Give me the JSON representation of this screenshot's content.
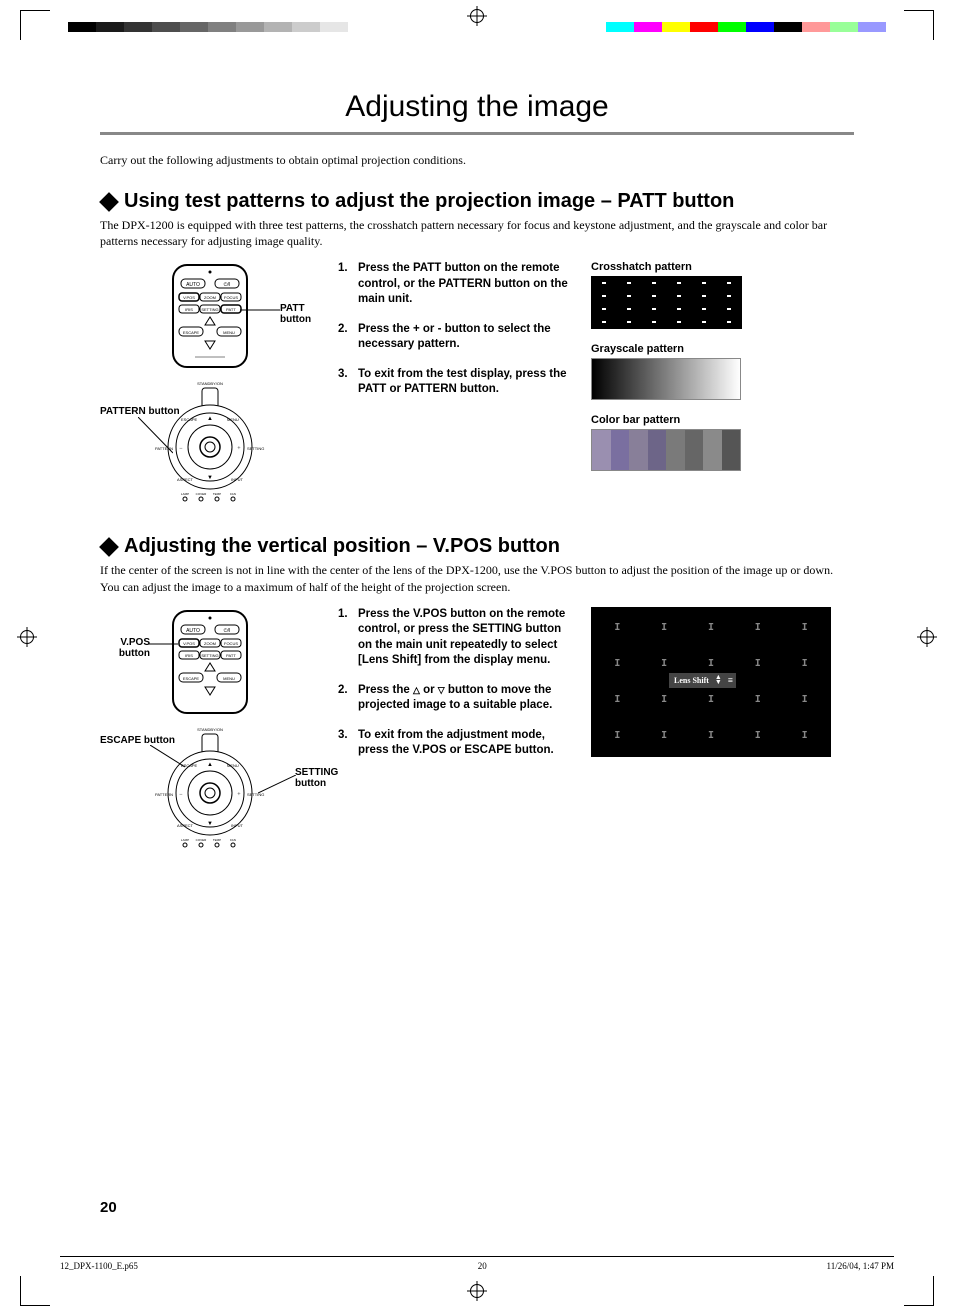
{
  "page_title": "Adjusting the image",
  "intro": "Carry out the following adjustments to obtain optimal projection conditions.",
  "section1": {
    "heading": "Using test patterns to adjust the projection image – PATT button",
    "body": "The DPX-1200 is equipped with three test patterns, the crosshatch pattern necessary for focus and keystone adjustment, and the grayscale and color bar patterns necessary for adjusting image quality.",
    "steps": [
      "Press the PATT button on the remote control, or the PATTERN button on the main unit.",
      "Press the + or - button to select the necessary pattern.",
      "To exit from the test display, press the PATT or PATTERN button."
    ],
    "callouts": {
      "patt": "PATT button",
      "pattern": "PATTERN button"
    },
    "patterns": {
      "crosshatch": "Crosshatch pattern",
      "grayscale": "Grayscale pattern",
      "colorbar": "Color bar pattern"
    }
  },
  "section2": {
    "heading": "Adjusting the vertical position – V.POS button",
    "body": "If the center of the screen is not in line with the center of the lens of the DPX-1200, use the V.POS button to adjust the position of the image up or down. You can adjust the image to a maximum of half of the height of the projection screen.",
    "steps": [
      "Press the V.POS button on the remote control, or press the SETTING button on the main unit repeatedly to select [Lens Shift] from the display menu.",
      "Press the △ or ▽ button to move the projected image to a suitable place.",
      "To exit from the adjustment mode, press the V.POS or ESCAPE button."
    ],
    "callouts": {
      "vpos": "V.POS button",
      "escape": "ESCAPE button",
      "setting": "SETTING button"
    },
    "lens_shift_label": "Lens Shift"
  },
  "remote": {
    "buttons": [
      "AUTO",
      "STANDBY",
      "V.POS",
      "ZOOM",
      "FOCUS",
      "IRIS",
      "SETTING",
      "PATT",
      "ESCAPE",
      "MENU"
    ]
  },
  "control_panel": {
    "labels": [
      "STANDBY/ON",
      "ESCAPE",
      "MENU",
      "PATTERN",
      "SETTING",
      "ASPECT",
      "INPUT"
    ],
    "leds": [
      "LAMP",
      "COVER",
      "TEMP",
      "FAN"
    ]
  },
  "colorbar_colors": [
    "#7f7fff",
    "#4d4dff",
    "#8888aa",
    "#5555aa",
    "#777777",
    "#666666",
    "#999999",
    "#555555"
  ],
  "page_number": "20",
  "footer": {
    "file": "12_DPX-1100_E.p65",
    "page": "20",
    "datetime": "11/26/04, 1:47 PM"
  }
}
